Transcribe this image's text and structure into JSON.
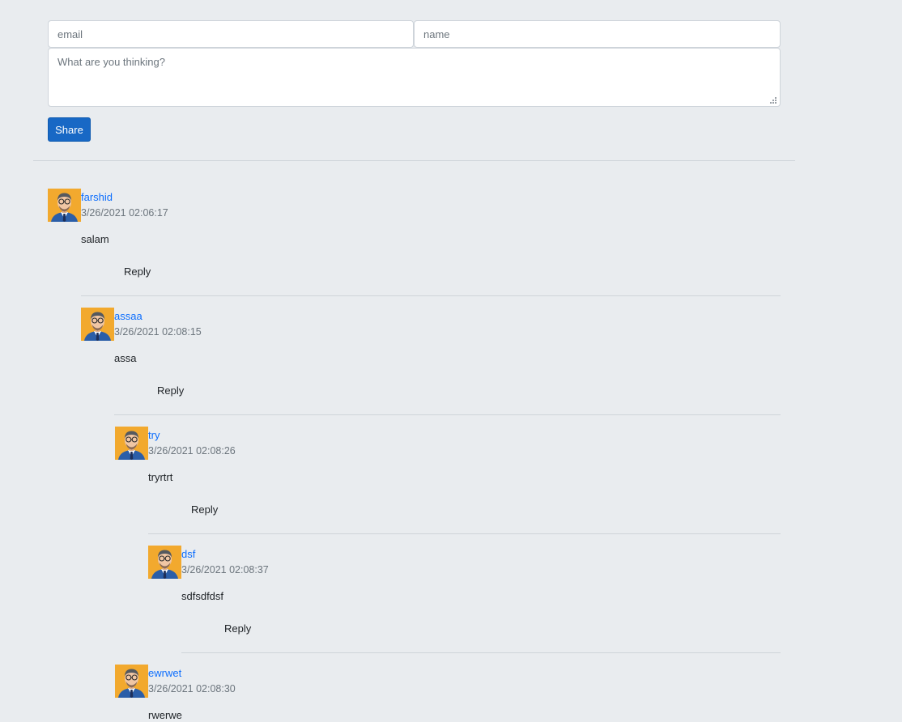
{
  "form": {
    "email_placeholder": "email",
    "name_placeholder": "name",
    "message_placeholder": "What are you thinking?",
    "share_label": "Share"
  },
  "colors": {
    "background": "#e9ecef",
    "link": "#0d6efd",
    "button": "#1868c5",
    "muted": "#6c757d"
  },
  "comments": [
    {
      "name": "farshid",
      "date": "3/26/2021 02:06:17",
      "text": "salam",
      "reply_label": "Reply",
      "avatar_icon": "user-avatar-icon"
    },
    {
      "name": "assaa",
      "date": "3/26/2021 02:08:15",
      "text": "assa",
      "reply_label": "Reply",
      "avatar_icon": "user-avatar-icon"
    },
    {
      "name": "try",
      "date": "3/26/2021 02:08:26",
      "text": "tryrtrt",
      "reply_label": "Reply",
      "avatar_icon": "user-avatar-icon"
    },
    {
      "name": "dsf",
      "date": "3/26/2021 02:08:37",
      "text": "sdfsdfdsf",
      "reply_label": "Reply",
      "avatar_icon": "user-avatar-icon"
    },
    {
      "name": "ewrwet",
      "date": "3/26/2021 02:08:30",
      "text": "rwerwe",
      "reply_label": "Reply",
      "avatar_icon": "user-avatar-icon"
    }
  ]
}
